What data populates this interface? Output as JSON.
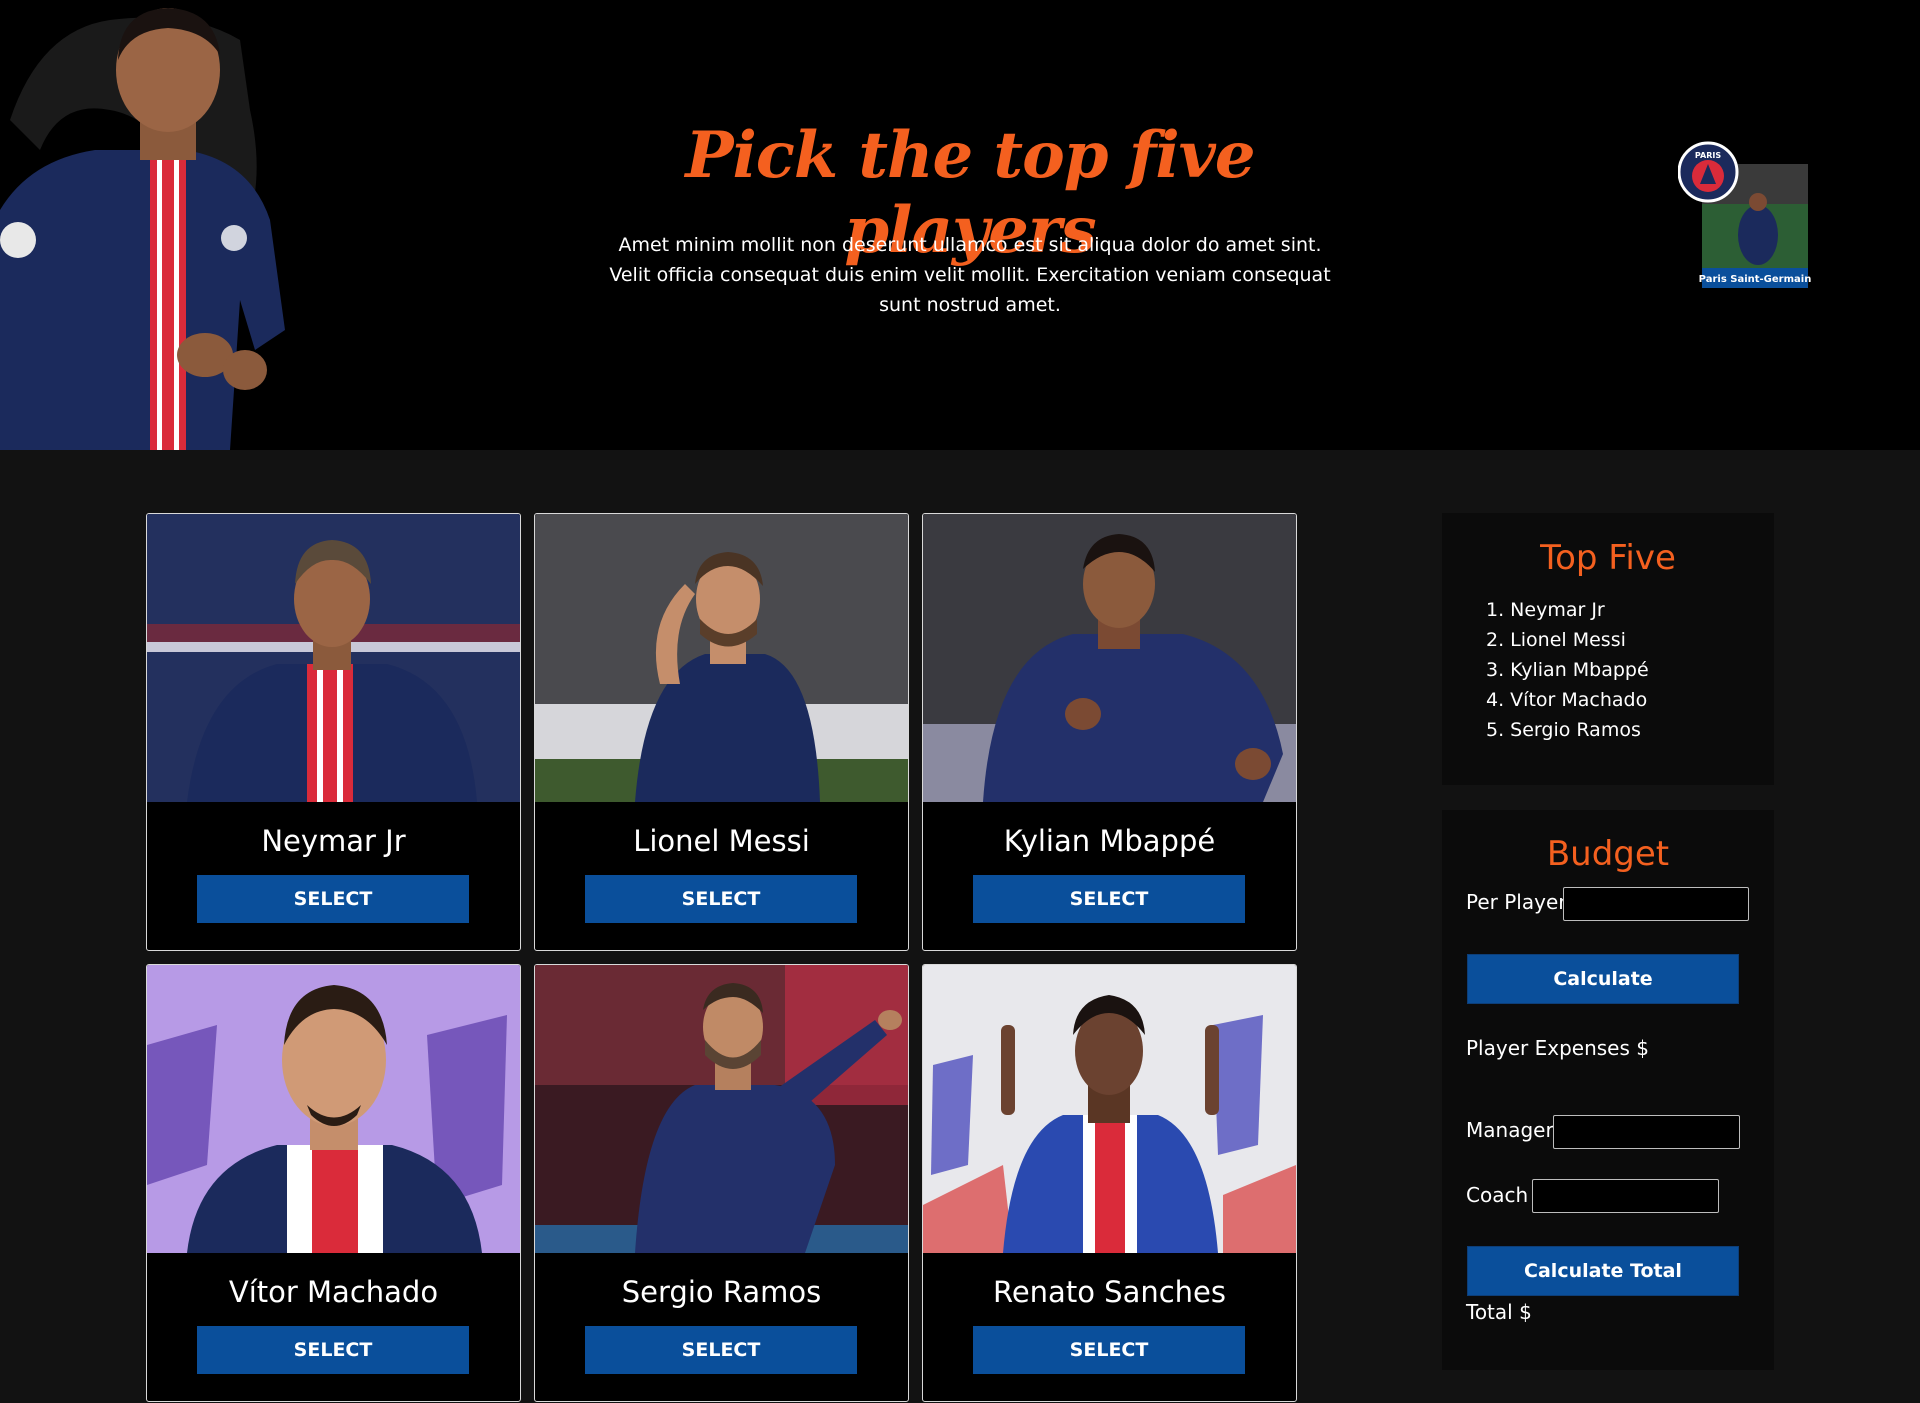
{
  "hero": {
    "title": "Pick the top five players",
    "description": "Amet minim mollit non deserunt ullamco est sit aliqua dolor do amet sint. Velit officia consequat duis enim velit mollit. Exercitation veniam consequat sunt nostrud amet.",
    "badge_text": "Paris Saint-Germain",
    "badge_crest": "PARIS"
  },
  "players": [
    {
      "name": "Neymar Jr",
      "button": "SELECT"
    },
    {
      "name": "Lionel Messi",
      "button": "SELECT"
    },
    {
      "name": "Kylian Mbappé",
      "button": "SELECT"
    },
    {
      "name": "Vítor Machado",
      "button": "SELECT"
    },
    {
      "name": "Sergio Ramos",
      "button": "SELECT"
    },
    {
      "name": "Renato Sanches",
      "button": "SELECT"
    }
  ],
  "top_five": {
    "title": "Top Five",
    "items": [
      "1. Neymar Jr",
      "2. Lionel Messi",
      "3. Kylian Mbappé",
      "4. Vítor Machado",
      "5. Sergio Ramos"
    ]
  },
  "budget": {
    "title": "Budget",
    "per_player_label": "Per Player",
    "per_player_value": "",
    "calculate_button": "Calculate",
    "player_expenses_label": "Player Expenses $",
    "manager_label": "Manager",
    "manager_value": "",
    "coach_label": "Coach",
    "coach_value": "",
    "calculate_total_button": "Calculate Total",
    "total_label": "Total $"
  },
  "colors": {
    "accent": "#f4601f",
    "button": "#0a4f9b",
    "psg_navy": "#1b2a5c",
    "psg_red": "#da2b3a"
  }
}
